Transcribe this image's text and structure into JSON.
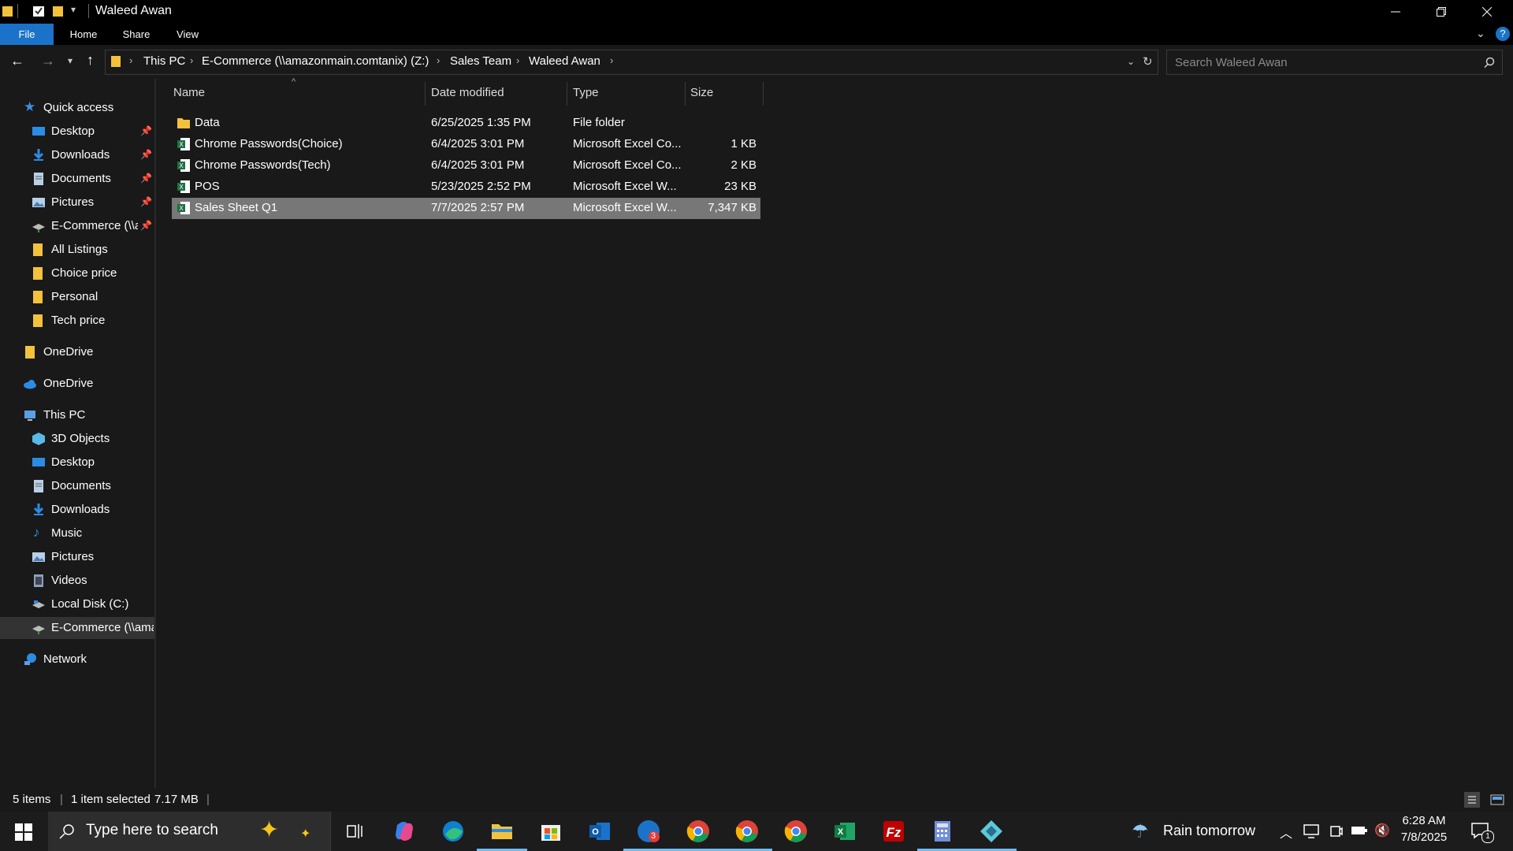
{
  "window": {
    "title": "Waleed Awan"
  },
  "ribbon": {
    "tabs": [
      "File",
      "Home",
      "Share",
      "View"
    ]
  },
  "address": {
    "crumbs": [
      "This PC",
      "E-Commerce (\\\\amazonmain.comtanix) (Z:)",
      "Sales Team",
      "Waleed Awan"
    ],
    "search_placeholder": "Search Waleed Awan"
  },
  "nav": {
    "quick_access": "Quick access",
    "quick_items": [
      "Desktop",
      "Downloads",
      "Documents",
      "Pictures",
      "E-Commerce (\\\\amazonmain.comtanix) (Z:)",
      "All Listings",
      "Choice price",
      "Personal",
      "Tech price"
    ],
    "onedrive_1": "OneDrive",
    "onedrive_2": "OneDrive",
    "this_pc": "This PC",
    "pc_items": [
      "3D Objects",
      "Desktop",
      "Documents",
      "Downloads",
      "Music",
      "Pictures",
      "Videos",
      "Local Disk (C:)",
      "E-Commerce (\\\\amazonmain.comtanix) (Z:)"
    ],
    "network": "Network"
  },
  "columns": {
    "name": "Name",
    "date": "Date modified",
    "type": "Type",
    "size": "Size"
  },
  "files": [
    {
      "name": "Data",
      "date": "6/25/2025 1:35 PM",
      "type": "File folder",
      "size": "",
      "kind": "folder",
      "selected": false
    },
    {
      "name": "Chrome Passwords(Choice)",
      "date": "6/4/2025 3:01 PM",
      "type": "Microsoft Excel Co...",
      "size": "1 KB",
      "kind": "excel",
      "selected": false
    },
    {
      "name": "Chrome Passwords(Tech)",
      "date": "6/4/2025 3:01 PM",
      "type": "Microsoft Excel Co...",
      "size": "2 KB",
      "kind": "excel",
      "selected": false
    },
    {
      "name": "POS",
      "date": "5/23/2025 2:52 PM",
      "type": "Microsoft Excel W...",
      "size": "23 KB",
      "kind": "excel",
      "selected": false
    },
    {
      "name": "Sales Sheet Q1",
      "date": "7/7/2025 2:57 PM",
      "type": "Microsoft Excel W...",
      "size": "7,347 KB",
      "kind": "excel",
      "selected": true
    }
  ],
  "status": {
    "count": "5 items",
    "selected": "1 item selected",
    "size": "7.17 MB"
  },
  "taskbar": {
    "search_placeholder": "Type here to search",
    "weather": "Rain tomorrow",
    "time": "6:28 AM",
    "date": "7/8/2025",
    "notifications": "1",
    "outlook_badge": "3"
  },
  "colors": {
    "accent": "#1a73c8",
    "folder": "#f2c23c",
    "excel": "#1d7044",
    "selected_row": "#777777"
  }
}
